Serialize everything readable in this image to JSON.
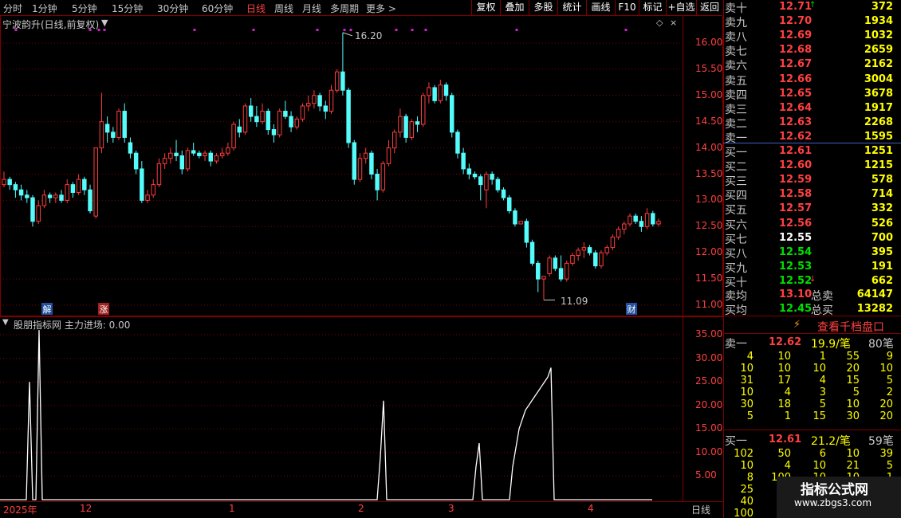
{
  "toolbar": {
    "periods": [
      "分时",
      "1分钟",
      "5分钟",
      "15分钟",
      "30分钟",
      "60分钟",
      "日线",
      "周线",
      "月线",
      "多周期",
      "更多 >"
    ],
    "active_period": "日线",
    "buttons": [
      "复权",
      "叠加",
      "多股",
      "统计",
      "画线",
      "F10",
      "标记",
      "+自选",
      "返回"
    ]
  },
  "main_chart": {
    "title": "宁波韵升(日线,前复权)",
    "high_label": "16.20",
    "low_label": "11.09",
    "markers": {
      "jie": "解",
      "zhang": "涨",
      "cai": "财"
    },
    "y_ticks": [
      "16.00",
      "15.50",
      "15.00",
      "14.50",
      "14.00",
      "13.50",
      "13.00",
      "12.50",
      "12.00",
      "11.50",
      "11.00"
    ],
    "colors": {
      "up": "#ff3c3c",
      "down": "#54fcfc",
      "axis": "#ff4040",
      "grid": "#800000"
    }
  },
  "indicator": {
    "title": "股朋指标网 主力进场: 0.00",
    "y_ticks": [
      "35.00",
      "30.00",
      "25.00",
      "20.00",
      "15.00",
      "10.00",
      "5.00"
    ]
  },
  "date_axis": {
    "labels": [
      "2025年",
      "12",
      "1",
      "2",
      "3",
      "4"
    ],
    "period_label": "日线"
  },
  "chart_data": [
    {
      "type": "candlestick",
      "title": "宁波韵升(日线,前复权)",
      "ylim": [
        10.9,
        16.5
      ],
      "candles": [
        [
          13.3,
          13.55,
          13.25,
          13.4
        ],
        [
          13.4,
          13.45,
          13.2,
          13.3
        ],
        [
          13.3,
          13.35,
          13.05,
          13.2
        ],
        [
          13.2,
          13.3,
          13.0,
          13.1
        ],
        [
          13.1,
          13.2,
          12.95,
          13.05
        ],
        [
          13.05,
          13.1,
          12.5,
          12.6
        ],
        [
          12.6,
          13.0,
          12.55,
          12.9
        ],
        [
          12.9,
          13.2,
          12.85,
          13.1
        ],
        [
          13.1,
          13.15,
          12.95,
          13.05
        ],
        [
          13.05,
          13.15,
          12.95,
          13.1
        ],
        [
          13.1,
          13.2,
          12.95,
          13.0
        ],
        [
          13.0,
          13.4,
          12.95,
          13.3
        ],
        [
          13.3,
          13.35,
          13.05,
          13.15
        ],
        [
          13.15,
          13.5,
          13.1,
          13.4
        ],
        [
          13.4,
          13.45,
          13.1,
          13.2
        ],
        [
          13.2,
          13.3,
          12.75,
          12.8
        ],
        [
          12.7,
          14.0,
          12.65,
          14.0
        ],
        [
          14.0,
          15.05,
          13.9,
          14.5
        ],
        [
          14.45,
          14.6,
          14.1,
          14.3
        ],
        [
          14.3,
          14.4,
          14.1,
          14.2
        ],
        [
          14.2,
          14.75,
          14.15,
          14.7
        ],
        [
          14.7,
          14.85,
          14.1,
          14.2
        ],
        [
          14.1,
          14.2,
          13.8,
          13.9
        ],
        [
          13.9,
          13.95,
          13.5,
          13.6
        ],
        [
          13.6,
          13.75,
          12.95,
          13.0
        ],
        [
          13.0,
          13.2,
          12.95,
          13.1
        ],
        [
          13.1,
          13.4,
          13.05,
          13.3
        ],
        [
          13.3,
          13.8,
          13.25,
          13.7
        ],
        [
          13.7,
          13.9,
          13.6,
          13.8
        ],
        [
          13.8,
          14.0,
          13.7,
          13.9
        ],
        [
          13.9,
          14.15,
          13.75,
          13.85
        ],
        [
          13.85,
          13.95,
          13.5,
          13.6
        ],
        [
          13.6,
          14.0,
          13.55,
          13.95
        ],
        [
          13.95,
          14.1,
          13.85,
          13.9
        ],
        [
          13.9,
          13.95,
          13.8,
          13.85
        ],
        [
          13.85,
          13.95,
          13.75,
          13.9
        ],
        [
          13.9,
          13.95,
          13.65,
          13.75
        ],
        [
          13.75,
          13.9,
          13.7,
          13.85
        ],
        [
          13.85,
          14.0,
          13.8,
          13.9
        ],
        [
          13.9,
          14.1,
          13.85,
          14.0
        ],
        [
          14.0,
          14.5,
          13.95,
          14.45
        ],
        [
          14.4,
          14.55,
          14.2,
          14.3
        ],
        [
          14.3,
          14.85,
          14.25,
          14.8
        ],
        [
          14.8,
          14.95,
          14.5,
          14.6
        ],
        [
          14.6,
          14.8,
          14.4,
          14.5
        ],
        [
          14.5,
          14.85,
          14.45,
          14.7
        ],
        [
          14.7,
          14.75,
          14.25,
          14.35
        ],
        [
          14.35,
          14.45,
          14.1,
          14.25
        ],
        [
          14.25,
          14.75,
          14.2,
          14.7
        ],
        [
          14.7,
          14.9,
          14.55,
          14.6
        ],
        [
          14.6,
          14.7,
          14.3,
          14.4
        ],
        [
          14.4,
          14.6,
          14.35,
          14.55
        ],
        [
          14.55,
          14.85,
          14.5,
          14.8
        ],
        [
          14.8,
          15.0,
          14.7,
          14.85
        ],
        [
          14.85,
          15.1,
          14.75,
          15.0
        ],
        [
          15.0,
          15.05,
          14.7,
          14.8
        ],
        [
          14.8,
          14.9,
          14.55,
          14.7
        ],
        [
          14.7,
          15.2,
          14.65,
          15.1
        ],
        [
          15.1,
          15.5,
          15.05,
          15.45
        ],
        [
          15.45,
          16.2,
          15.0,
          15.1
        ],
        [
          15.1,
          15.15,
          14.0,
          14.1
        ],
        [
          14.1,
          14.15,
          13.3,
          13.4
        ],
        [
          13.4,
          13.9,
          13.35,
          13.8
        ],
        [
          13.8,
          14.0,
          13.7,
          13.9
        ],
        [
          13.9,
          13.95,
          13.4,
          13.5
        ],
        [
          13.5,
          13.6,
          13.0,
          13.2
        ],
        [
          13.2,
          13.75,
          13.15,
          13.7
        ],
        [
          13.7,
          14.15,
          13.65,
          14.0
        ],
        [
          14.0,
          14.35,
          13.9,
          14.3
        ],
        [
          14.3,
          14.75,
          14.2,
          14.6
        ],
        [
          14.6,
          14.65,
          14.1,
          14.2
        ],
        [
          14.2,
          14.55,
          14.15,
          14.5
        ],
        [
          14.5,
          14.6,
          14.3,
          14.45
        ],
        [
          14.45,
          15.05,
          14.4,
          15.0
        ],
        [
          15.0,
          15.25,
          14.85,
          15.15
        ],
        [
          15.15,
          15.2,
          14.85,
          14.9
        ],
        [
          14.9,
          15.3,
          14.85,
          15.2
        ],
        [
          15.2,
          15.25,
          14.9,
          15.0
        ],
        [
          15.0,
          15.05,
          14.2,
          14.3
        ],
        [
          14.3,
          14.35,
          13.8,
          13.9
        ],
        [
          13.9,
          14.0,
          13.5,
          13.6
        ],
        [
          13.6,
          13.7,
          13.4,
          13.5
        ],
        [
          13.5,
          13.55,
          13.4,
          13.45
        ],
        [
          13.45,
          13.5,
          13.0,
          13.3
        ],
        [
          13.2,
          13.55,
          12.85,
          13.5
        ],
        [
          13.5,
          13.55,
          13.3,
          13.4
        ],
        [
          13.4,
          13.45,
          13.15,
          13.2
        ],
        [
          13.2,
          13.25,
          13.0,
          13.05
        ],
        [
          13.05,
          13.1,
          12.75,
          12.8
        ],
        [
          12.8,
          12.85,
          12.5,
          12.55
        ],
        [
          12.55,
          12.6,
          12.55,
          12.6
        ],
        [
          12.6,
          12.65,
          12.1,
          12.2
        ],
        [
          12.2,
          12.25,
          11.75,
          11.8
        ],
        [
          11.8,
          11.85,
          11.25,
          11.5
        ],
        [
          11.5,
          11.55,
          11.1,
          11.55
        ],
        [
          11.6,
          11.95,
          11.55,
          11.9
        ],
        [
          11.9,
          11.95,
          11.65,
          11.7
        ],
        [
          11.7,
          11.95,
          11.45,
          11.5
        ],
        [
          11.5,
          11.85,
          11.45,
          11.8
        ],
        [
          11.8,
          12.0,
          11.75,
          11.95
        ],
        [
          11.95,
          12.1,
          11.85,
          12.05
        ],
        [
          12.05,
          12.2,
          11.9,
          12.1
        ],
        [
          12.1,
          12.15,
          11.95,
          12.0
        ],
        [
          12.0,
          12.05,
          11.7,
          11.75
        ],
        [
          11.75,
          12.05,
          11.7,
          12.0
        ],
        [
          12.0,
          12.15,
          11.95,
          12.1
        ],
        [
          12.1,
          12.35,
          12.05,
          12.3
        ],
        [
          12.3,
          12.5,
          12.25,
          12.45
        ],
        [
          12.45,
          12.6,
          12.35,
          12.55
        ],
        [
          12.55,
          12.75,
          12.5,
          12.7
        ],
        [
          12.7,
          12.75,
          12.55,
          12.6
        ],
        [
          12.6,
          12.7,
          12.4,
          12.5
        ],
        [
          12.5,
          12.85,
          12.45,
          12.75
        ],
        [
          12.75,
          12.8,
          12.5,
          12.55
        ],
        [
          12.55,
          12.65,
          12.5,
          12.6
        ]
      ]
    },
    {
      "type": "line",
      "title": "股朋指标网 主力进场: 0.00",
      "ylim": [
        0,
        37
      ],
      "x": [
        0,
        29,
        33,
        37,
        41,
        45,
        49,
        53,
        57,
        469,
        473,
        477,
        481,
        485,
        589,
        593,
        597,
        601,
        605,
        635,
        639,
        643,
        647,
        651,
        655,
        659,
        663,
        667,
        671,
        675,
        679,
        683,
        687,
        691,
        695,
        818
      ],
      "values": [
        0,
        0,
        0,
        25,
        0,
        0,
        36,
        0,
        0,
        0,
        0,
        9,
        21,
        0,
        0,
        0,
        7,
        12,
        0,
        0,
        0,
        7,
        11,
        15,
        17,
        19,
        20,
        21,
        22,
        23,
        24,
        25,
        26,
        28,
        0,
        0
      ]
    }
  ],
  "orderbook": {
    "sell": [
      {
        "label": "卖十",
        "price": "12.71",
        "vol": "372",
        "mark": "↑"
      },
      {
        "label": "卖九",
        "price": "12.70",
        "vol": "1934"
      },
      {
        "label": "卖八",
        "price": "12.69",
        "vol": "1032"
      },
      {
        "label": "卖七",
        "price": "12.68",
        "vol": "2659"
      },
      {
        "label": "卖六",
        "price": "12.67",
        "vol": "2162"
      },
      {
        "label": "卖五",
        "price": "12.66",
        "vol": "3004"
      },
      {
        "label": "卖四",
        "price": "12.65",
        "vol": "3678"
      },
      {
        "label": "卖三",
        "price": "12.64",
        "vol": "1917"
      },
      {
        "label": "卖二",
        "price": "12.63",
        "vol": "2268"
      },
      {
        "label": "卖一",
        "price": "12.62",
        "vol": "1595"
      }
    ],
    "buy": [
      {
        "label": "买一",
        "price": "12.61",
        "vol": "1251",
        "color": "#ff4040"
      },
      {
        "label": "买二",
        "price": "12.60",
        "vol": "1215",
        "color": "#ff4040"
      },
      {
        "label": "买三",
        "price": "12.59",
        "vol": "578",
        "color": "#ff4040"
      },
      {
        "label": "买四",
        "price": "12.58",
        "vol": "714",
        "color": "#ff4040"
      },
      {
        "label": "买五",
        "price": "12.57",
        "vol": "332",
        "color": "#ff4040"
      },
      {
        "label": "买六",
        "price": "12.56",
        "vol": "526",
        "color": "#ff4040"
      },
      {
        "label": "买七",
        "price": "12.55",
        "vol": "700",
        "color": "#ffffff"
      },
      {
        "label": "买八",
        "price": "12.54",
        "vol": "395",
        "color": "#00e000"
      },
      {
        "label": "买九",
        "price": "12.53",
        "vol": "191",
        "color": "#00e000"
      },
      {
        "label": "买十",
        "price": "12.52",
        "vol": "662",
        "color": "#00e000",
        "mark": "↓"
      }
    ],
    "avg_sell": {
      "label": "卖均",
      "price": "13.10",
      "total_label": "总卖",
      "total": "64147"
    },
    "avg_buy": {
      "label": "买均",
      "price": "12.45",
      "total_label": "总买",
      "total": "13282"
    },
    "qianfang_label": "查看千档盘口",
    "sell1_detail": {
      "label": "卖一",
      "price": "12.62",
      "avg": "19.9/笔",
      "count": "80笔"
    },
    "sell1_ticks": [
      [
        "4",
        "10",
        "1",
        "55",
        "9"
      ],
      [
        "10",
        "10",
        "10",
        "20",
        "10"
      ],
      [
        "31",
        "17",
        "4",
        "15",
        "5"
      ],
      [
        "10",
        "4",
        "3",
        "5",
        "2"
      ],
      [
        "30",
        "18",
        "5",
        "10",
        "20"
      ],
      [
        "5",
        "1",
        "15",
        "30",
        "20"
      ]
    ],
    "buy1_detail": {
      "label": "买一",
      "price": "12.61",
      "avg": "21.2/笔",
      "count": "59笔"
    },
    "buy1_ticks": [
      [
        "102",
        "50",
        "6",
        "10",
        "39"
      ],
      [
        "10",
        "4",
        "10",
        "21",
        "5"
      ],
      [
        "8",
        "100",
        "10",
        "10",
        "1"
      ],
      [
        "25",
        "",
        "",
        "",
        ""
      ],
      [
        "40",
        "",
        "",
        "",
        ""
      ],
      [
        "100",
        "",
        "",
        "",
        ""
      ]
    ]
  },
  "watermark": {
    "line1": "指标公式网",
    "line2": "www.zbgs3.com"
  }
}
